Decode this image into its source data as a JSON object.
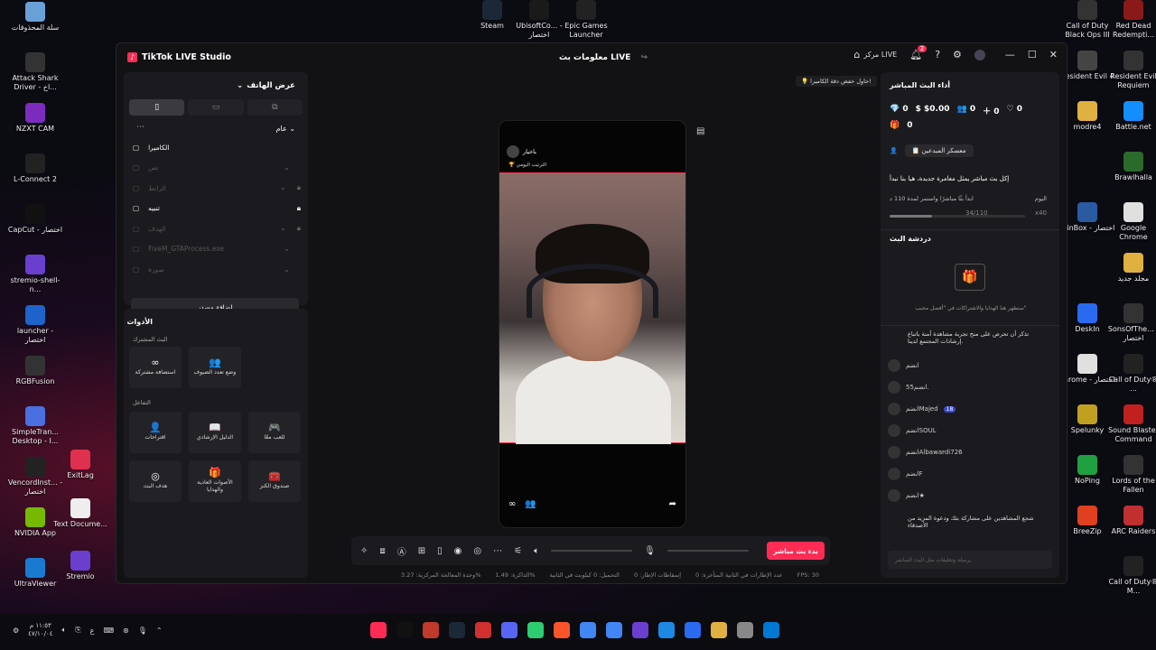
{
  "desktop_left": [
    {
      "label": "سلة المحذوفات",
      "color": "#6aa0d8"
    },
    {
      "label": "Attack Shark Driver - اخ...",
      "color": "#333"
    },
    {
      "label": "NZXT CAM",
      "color": "#7b2cbf"
    },
    {
      "label": "L-Connect 2",
      "color": "#222"
    },
    {
      "label": "CapCut - اختصار",
      "color": "#111"
    },
    {
      "label": "stremio-shell-n...",
      "color": "#6a3fd0"
    },
    {
      "label": "launcher - اختصار",
      "color": "#1e63c9"
    },
    {
      "label": "RGBFusion",
      "color": "#333"
    },
    {
      "label": "SimpleTran... Desktop - I...",
      "color": "#4a6fe0"
    },
    {
      "label": "VencordInst... - اختصار",
      "color": "#222"
    },
    {
      "label": "NVIDIA App",
      "color": "#76b900"
    },
    {
      "label": "UltraViewer",
      "color": "#1a7ad0"
    }
  ],
  "desktop_left2": [
    {
      "label": "ExitLag",
      "color": "#e03050"
    },
    {
      "label": "Text Docume...",
      "color": "#eee"
    },
    {
      "label": "Stremio",
      "color": "#6a3fd0"
    }
  ],
  "desktop_top": [
    {
      "label": "Steam",
      "color": "#1b2838"
    },
    {
      "label": "UbisoftCo... - اختصار",
      "color": "#1a1a1a"
    },
    {
      "label": "Epic Games Launcher",
      "color": "#222"
    }
  ],
  "desktop_right": [
    {
      "label": "Call of Duty Black Ops III",
      "color": "#333"
    },
    {
      "label": "Red Dead Redempti...",
      "color": "#8a1a1a"
    },
    {
      "label": "Resident Evil 4",
      "color": "#444"
    },
    {
      "label": "Resident Evil Requiem",
      "color": "#333"
    },
    {
      "label": "modre4",
      "color": "#e0b040"
    },
    {
      "label": "Battle.net",
      "color": "#148eff"
    },
    {
      "label": "Brawlhalla",
      "color": "#2a6a2a"
    },
    {
      "label": "WinBox - اختصار",
      "color": "#2a5aa0"
    },
    {
      "label": "Google Chrome",
      "color": "#e0e0e0"
    },
    {
      "label": "مجلد جديد",
      "color": "#e0b040"
    },
    {
      "label": "DeskIn",
      "color": "#2a6af0"
    },
    {
      "label": "SonsOfThe... - اختصار",
      "color": "#333"
    },
    {
      "label": "chrome - اختصار",
      "color": "#e0e0e0"
    },
    {
      "label": "Call of Duty® ...",
      "color": "#222"
    },
    {
      "label": "Spelunky",
      "color": "#c0a020"
    },
    {
      "label": "Sound Blaster Command",
      "color": "#c02020"
    },
    {
      "label": "NoPing",
      "color": "#20a040"
    },
    {
      "label": "Lords of the Fallen",
      "color": "#333"
    },
    {
      "label": "BreeZip",
      "color": "#e04020"
    },
    {
      "label": "ARC Raiders",
      "color": "#c03030"
    },
    {
      "label": "Call of Duty® M...",
      "color": "#222"
    }
  ],
  "window": {
    "app_title": "TikTok LIVE Studio",
    "center_title": "معلومات بث LIVE",
    "center_btn": "مركز LIVE",
    "notif_count": "2",
    "tip": "حاول خفض دقة الكاميرا!"
  },
  "left": {
    "view_label": "عرض الهاتف",
    "scene_label": "عام",
    "sources": [
      {
        "name": "الكاميرا",
        "active": true,
        "lock": false
      },
      {
        "name": "نص",
        "active": false,
        "lock": false
      },
      {
        "name": "الرابط",
        "active": false,
        "lock": true
      },
      {
        "name": "تنبيه",
        "active": true,
        "lock": true
      },
      {
        "name": "الهدف",
        "active": false,
        "lock": true
      },
      {
        "name": "FiveM_GTAProcess.exe",
        "active": false,
        "lock": false
      },
      {
        "name": "صورة",
        "active": false,
        "lock": false
      }
    ],
    "add_source": "إضافة مصدر",
    "tools_title": "الأدوات",
    "shared_live": "البث المشترك",
    "interaction": "التفاعل",
    "tools": [
      {
        "label": "استضافة مشتركة",
        "icon": "∞"
      },
      {
        "label": "وضع تعدد الضيوف",
        "icon": "👥"
      },
      {
        "label": "اقتراحات",
        "icon": "👤"
      },
      {
        "label": "الدليل الإرشادي",
        "icon": "📖"
      },
      {
        "label": "للعب معًا",
        "icon": "🎮"
      },
      {
        "label": "هدف البث",
        "icon": "◎"
      },
      {
        "label": "الأصوات العادية والهدايا",
        "icon": "🎁"
      },
      {
        "label": "صندوق الكنز",
        "icon": "🧰"
      }
    ]
  },
  "preview": {
    "username": "باخيار",
    "rank": "الترتيب اليومي"
  },
  "bottom": {
    "golive": "بدء بث مباشر",
    "status": [
      "وحدة المعالجة المركزية: 3.27%",
      "الذاكرة: 1.49%",
      "التحميل: 0 كيلوبت في الثانية",
      "إسقاطات الإطار: 0",
      "عدد الإطارات في الثانية المتأخرة: 0",
      "FPS: 30"
    ]
  },
  "right": {
    "perf_title": "أداء البث المباشر",
    "stats": {
      "diamonds": "0",
      "money": "$0.00",
      "viewers": "0",
      "followers": "0",
      "likes": "0",
      "gifts": "0"
    },
    "creator_btn": "معسكر المبدعين",
    "promo": "إكل بث مباشر يمثل مغامرة جديدة، هيا بنا نبدأ",
    "today": "اليوم",
    "goal_text": "ابدأ بثًا مباشرًا واستمر لمدة 110 د",
    "goal_progress": "34/110",
    "goal_reward": "x40",
    "chat_title": "دردشة البث",
    "gift_hint": "ستظهر هنا الهدايا والاشتراكات في \"أفضل محبب\"",
    "notice": "تذكر أن تحرص على منح تجربة مشاهدة آمنة باتباع إرشادات المجتمع لدينا.",
    "chat": [
      {
        "name": "انضم",
        "lvl": ""
      },
      {
        "name": "انضم55.",
        "lvl": ""
      },
      {
        "name": "انضمMajed",
        "lvl": "18"
      },
      {
        "name": "انضمSOUL",
        "lvl": ""
      },
      {
        "name": "انضمAlbawardi726",
        "lvl": ""
      },
      {
        "name": "انضمF",
        "lvl": ""
      },
      {
        "name": "انضم★",
        "lvl": ""
      }
    ],
    "share_hint": "شجع المشاهدين على مشاركة بثك ودعوة المزيد من الأصدقاء",
    "input_placeholder": "يرسلة وتعليقات مثل البث المباشر"
  },
  "taskbar": {
    "time": "١١:٥٣ م",
    "date": "٤٧/١٠/٠٤"
  }
}
